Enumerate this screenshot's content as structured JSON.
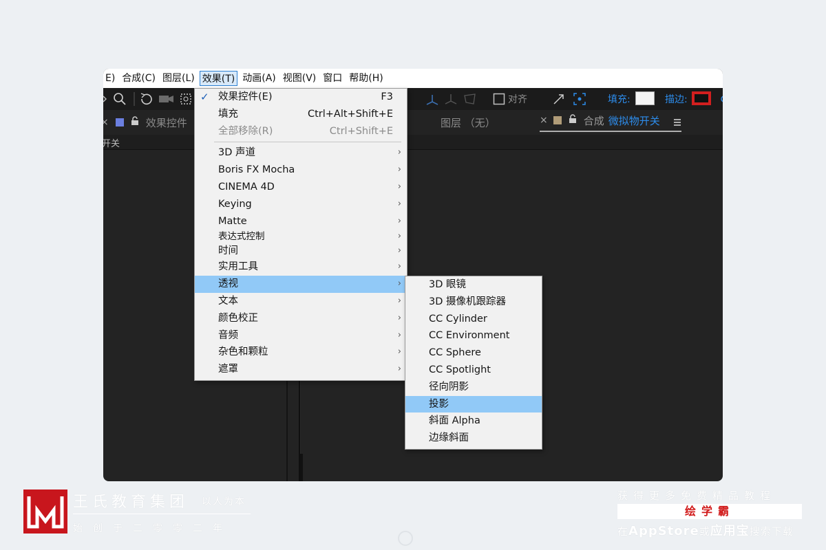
{
  "menubar": {
    "items": [
      "E)",
      "合成(C)",
      "图层(L)",
      "效果(T)",
      "动画(A)",
      "视图(V)",
      "窗口",
      "帮助(H)"
    ],
    "active_index": 3
  },
  "toolbar": {
    "align_label": "对齐",
    "fill_label": "填充:",
    "stroke_label": "描边:",
    "fill_color": "#f4f4f4",
    "stroke_color": "#d21f1f"
  },
  "panels": {
    "effects_controls": "效果控件",
    "layer_panel": "图层 （无）",
    "comp_prefix": "合成",
    "comp_name": "微拟物开关",
    "sub_label": "开关"
  },
  "effects_menu": {
    "top_items": [
      {
        "label": "效果控件(E)",
        "shortcut": "F3",
        "checked": true
      },
      {
        "label": "填充",
        "shortcut": "Ctrl+Alt+Shift+E"
      },
      {
        "label": "全部移除(R)",
        "shortcut": "Ctrl+Shift+E",
        "disabled": true
      }
    ],
    "categories": [
      "3D 声道",
      "Boris FX Mocha",
      "CINEMA 4D",
      "Keying",
      "Matte",
      "表达式控制",
      "时间",
      "实用工具",
      "透视",
      "文本",
      "颜色校正",
      "音频",
      "杂色和颗粒",
      "遮罩"
    ],
    "highlighted": "透视",
    "submenu_arrow": "›"
  },
  "perspective_submenu": {
    "items": [
      "3D 眼镜",
      "3D 摄像机跟踪器",
      "CC Cylinder",
      "CC Environment",
      "CC Sphere",
      "CC Spotlight",
      "径向阴影",
      "投影",
      "斜面 Alpha",
      "边缘斜面"
    ],
    "highlighted": "投影"
  },
  "branding": {
    "name": "王氏教育集团",
    "slogan": "以人为本",
    "subtitle": "始创于二零零二年",
    "promo_line1": "获得更多免费精品教程",
    "promo_app": "绘学霸",
    "promo_in": "在",
    "promo_appstore": "AppStore",
    "promo_or": "或",
    "promo_yyb": "应用宝",
    "promo_search": "搜索下载",
    "accent_color": "#c8161d"
  }
}
